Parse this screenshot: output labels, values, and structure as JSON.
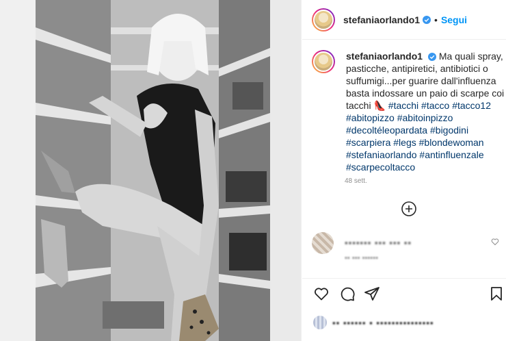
{
  "post": {
    "image_alt": "Woman with blonde bob hair in black lace bodysuit posing in a shoe closet, black and white photo"
  },
  "header": {
    "username": "stefaniaorlando1",
    "separator": "•",
    "follow_label": "Segui"
  },
  "caption": {
    "username": "stefaniaorlando1",
    "text": "Ma quali spray, pasticche, antipiretici, antibiotici o suffumigi...per guarire dall'influenza basta indossare un paio di scarpe coi tacchi",
    "emoji": "👠",
    "hashtags": [
      "#tacchi",
      "#tacco",
      "#tacco12",
      "#abitopizzo",
      "#abitoinpizzo",
      "#decoltéleopardata",
      "#bigodini",
      "#scarpiera",
      "#legs",
      "#blondewoman",
      "#stefaniaorlando",
      "#antinfluenzale",
      "#scarpecoltacco"
    ],
    "time": "48 sett."
  },
  "comment": {
    "text": "▪▪▪▪▪▪▪ ▪▪▪ ▪▪▪ ▪▪",
    "meta": "▪▪ ▪▪▪ ▪▪▪▪▪▪"
  },
  "likes": {
    "text": "▪▪ ▪▪▪▪▪▪ ▪ ▪▪▪▪▪▪▪▪▪▪▪▪▪▪▪"
  },
  "colors": {
    "accent": "#0095f6",
    "hashtag": "#00376b",
    "verified": "#3897f0",
    "border": "#efefef",
    "muted": "#8e8e8e"
  },
  "icons": {
    "verified": "verified-badge-icon",
    "load_more": "plus-circle-icon",
    "like": "heart-icon",
    "comment": "comment-icon",
    "share": "paper-plane-icon",
    "save": "bookmark-icon"
  }
}
